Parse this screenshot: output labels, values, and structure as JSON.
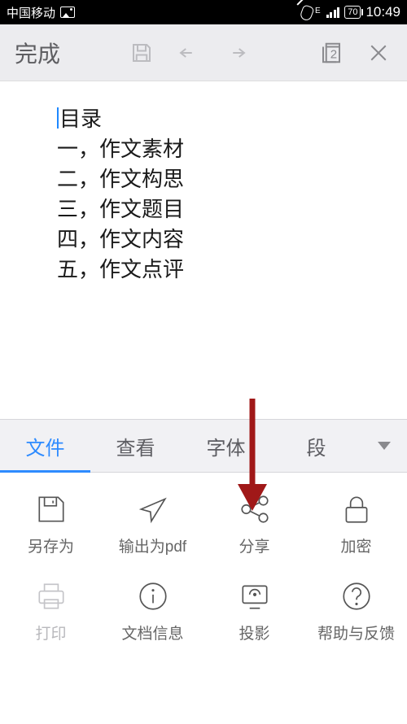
{
  "status": {
    "carrier": "中国移动",
    "battery": "70",
    "time": "10:49"
  },
  "toolbar": {
    "done": "完成",
    "page_number": "2"
  },
  "document": {
    "title": "目录",
    "lines": [
      "一，作文素材",
      "二，作文构思",
      "三，作文题目",
      "四，作文内容",
      "五，作文点评"
    ]
  },
  "tabs": {
    "file": "文件",
    "view": "查看",
    "font": "字体",
    "paragraph": "段"
  },
  "actions": {
    "save_as": "另存为",
    "export_pdf": "输出为pdf",
    "share": "分享",
    "encrypt": "加密",
    "print": "打印",
    "doc_info": "文档信息",
    "project": "投影",
    "help": "帮助与反馈"
  }
}
